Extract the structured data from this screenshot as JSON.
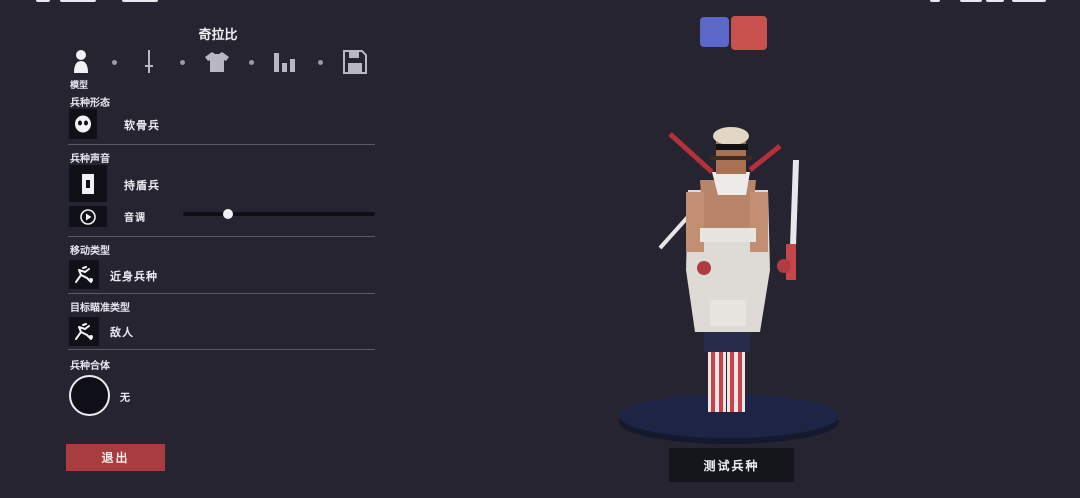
{
  "unit": {
    "name": "奇拉比"
  },
  "tabs": {
    "active_label": "模型",
    "items": [
      {
        "icon": "person-icon",
        "selected": true
      },
      {
        "icon": "sword-icon"
      },
      {
        "icon": "shirt-icon"
      },
      {
        "icon": "bar-chart-icon"
      },
      {
        "icon": "floppy-disk-icon"
      }
    ]
  },
  "sections": {
    "form": {
      "title": "兵种形态",
      "value": "软骨兵",
      "icon": "mask-icon"
    },
    "voice": {
      "title": "兵种声音",
      "value": "持盾兵",
      "icon": "shield-unit-icon",
      "pitch_label": "音调",
      "pitch_level": 0.22,
      "play_icon": "play-icon"
    },
    "movement": {
      "title": "移动类型",
      "value": "近身兵种",
      "icon": "running-unit-icon"
    },
    "targeting": {
      "title": "目标瞄准类型",
      "value": "敌人",
      "icon": "running-unit-icon"
    },
    "fusion": {
      "title": "兵种合体",
      "value": "无"
    }
  },
  "buttons": {
    "exit": "退出",
    "test": "测试兵种"
  },
  "team_colors": {
    "blue": "#5b68c8",
    "red": "#c9524f"
  }
}
